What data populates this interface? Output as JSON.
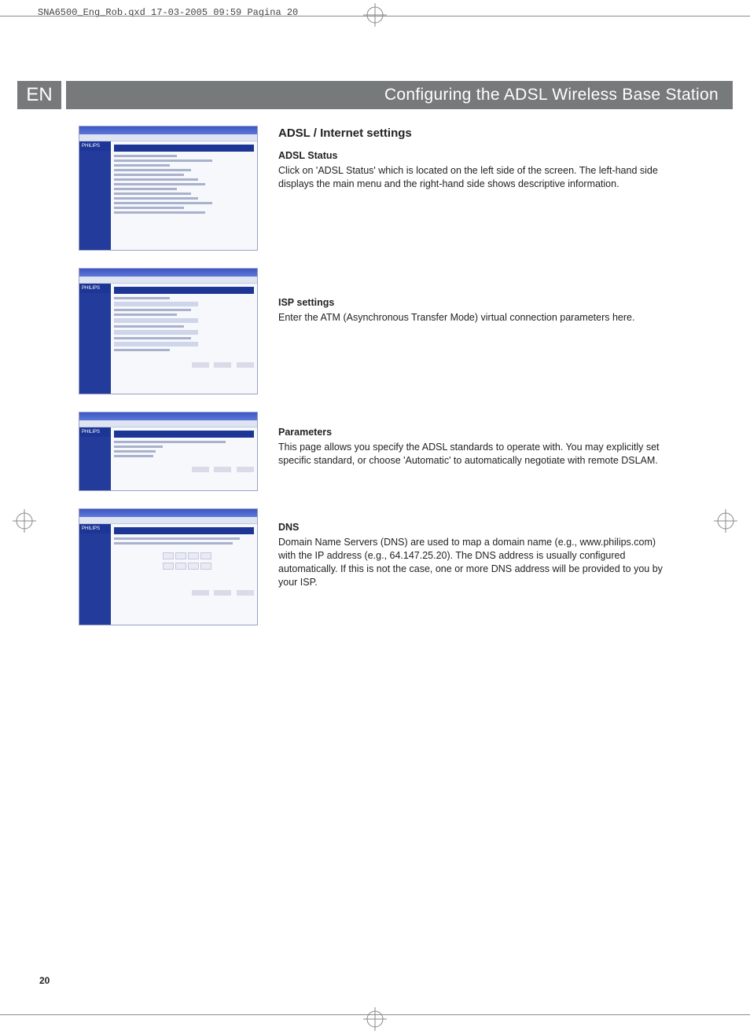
{
  "run_header": "SNA6500_Eng_Rob.qxd  17-03-2005  09:59  Pagina 20",
  "lang_code": "EN",
  "title": "Configuring the ADSL Wireless Base Station",
  "h2": "ADSL / Internet settings",
  "sections": {
    "s1_h": "ADSL Status",
    "s1_p": "Click on 'ADSL Status' which is located on the left side of the screen. The left-hand side displays the main menu and the right-hand side shows descriptive information.",
    "s2_h": "ISP settings",
    "s2_p": "Enter the ATM (Asynchronous Transfer Mode) virtual connection parameters here.",
    "s3_h": "Parameters",
    "s3_p": "This page allows you specify the ADSL standards to operate with. You may explicitly set specific standard, or choose 'Automatic' to automatically negotiate with remote DSLAM.",
    "s4_h": "DNS",
    "s4_p": "Domain Name Servers (DNS) are used to map a domain name (e.g., www.philips.com) with the IP address (e.g., 64.147.25.20). The DNS address is usually configured automatically. If this is not the case, one or more DNS address will be provided to you by your ISP."
  },
  "page_no": "20",
  "thumb_brand": "PHILIPS"
}
